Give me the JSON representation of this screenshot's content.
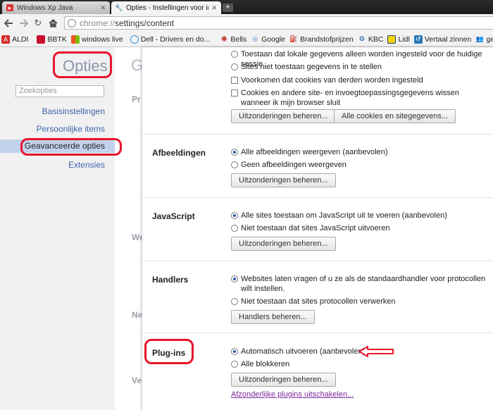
{
  "tabs": [
    {
      "title": "Windows Xp Java",
      "active": false
    },
    {
      "title": "Opties - Instellingen voor in",
      "active": true
    }
  ],
  "toolbar": {
    "url_scheme": "chrome://",
    "url_path": "settings/content"
  },
  "bookmarks": [
    {
      "label": "ALDI",
      "icon": "aldi-icon",
      "color": "#d62b2b"
    },
    {
      "label": "BBTK",
      "icon": "bbtk-icon",
      "color": "#c8102e"
    },
    {
      "label": "windows live",
      "icon": "windows-icon",
      "color": "#2f7fd8"
    },
    {
      "label": "Dell - Drivers en do...",
      "icon": "dell-icon",
      "color": "#3a8fd1"
    },
    {
      "label": "Bells",
      "icon": "bells-icon",
      "color": "#c0392b"
    },
    {
      "label": "Google",
      "icon": "google-icon",
      "color": "#3a75c4"
    },
    {
      "label": "Brandstofprijzen",
      "icon": "fuel-icon",
      "color": "#333333"
    },
    {
      "label": "KBC",
      "icon": "kbc-icon",
      "color": "#2b6cb0"
    },
    {
      "label": "Lidl",
      "icon": "lidl-icon",
      "color": "#f5d400"
    },
    {
      "label": "Vertaal zinnen",
      "icon": "translate-icon",
      "color": "#2a7ab8"
    },
    {
      "label": "gem",
      "icon": "people-icon",
      "color": "#3a75c4"
    }
  ],
  "leftnav": {
    "title": "Opties",
    "search_placeholder": "Zoekopties",
    "items": [
      {
        "label": "Basisinstellingen",
        "selected": false
      },
      {
        "label": "Persoonlijke items",
        "selected": false
      },
      {
        "label": "Geavanceerde opties",
        "selected": true
      },
      {
        "label": "Extensies",
        "selected": false
      }
    ]
  },
  "background_page": {
    "heading_fragment": "G",
    "labels": [
      "Pr",
      "We",
      "Ne",
      "Ve"
    ]
  },
  "cookies": {
    "options": [
      {
        "label": "Toestaan dat lokale gegevens alleen worden ingesteld voor de huidige sessie",
        "type": "radio",
        "checked": false
      },
      {
        "label": "Sites niet toestaan gegevens in te stellen",
        "type": "radio",
        "checked": false
      },
      {
        "label": "Voorkomen dat cookies van derden worden ingesteld",
        "type": "checkbox",
        "checked": false
      },
      {
        "label": "Cookies en andere site- en invoegtoepassingsgegevens wissen wanneer ik mijn browser sluit",
        "type": "checkbox",
        "checked": false
      }
    ],
    "buttons": [
      "Uitzonderingen beheren...",
      "Alle cookies en sitegegevens..."
    ]
  },
  "afbeeldingen": {
    "title": "Afbeeldingen",
    "options": [
      {
        "label": "Alle afbeeldingen weergeven (aanbevolen)",
        "checked": true
      },
      {
        "label": "Geen afbeeldingen weergeven",
        "checked": false
      }
    ],
    "button": "Uitzonderingen beheren..."
  },
  "javascript": {
    "title": "JavaScript",
    "options": [
      {
        "label": "Alle sites toestaan om JavaScript uit te voeren (aanbevolen)",
        "checked": true
      },
      {
        "label": "Niet toestaan dat sites JavaScript uitvoeren",
        "checked": false
      }
    ],
    "button": "Uitzonderingen beheren..."
  },
  "handlers": {
    "title": "Handlers",
    "options": [
      {
        "label": "Websites laten vragen of u ze als de standaardhandler voor protocollen wilt instellen.",
        "checked": true
      },
      {
        "label": "Niet toestaan dat sites protocollen verwerken",
        "checked": false
      }
    ],
    "button": "Handlers beheren..."
  },
  "plugins": {
    "title": "Plug-ins",
    "options": [
      {
        "label": "Automatisch uitvoeren (aanbevolen)",
        "checked": true
      },
      {
        "label": "Alle blokkeren",
        "checked": false
      }
    ],
    "button": "Uitzonderingen beheren...",
    "link": "Afzonderlijke plugins uitschakelen..."
  },
  "annotation_color": "#e8152b"
}
